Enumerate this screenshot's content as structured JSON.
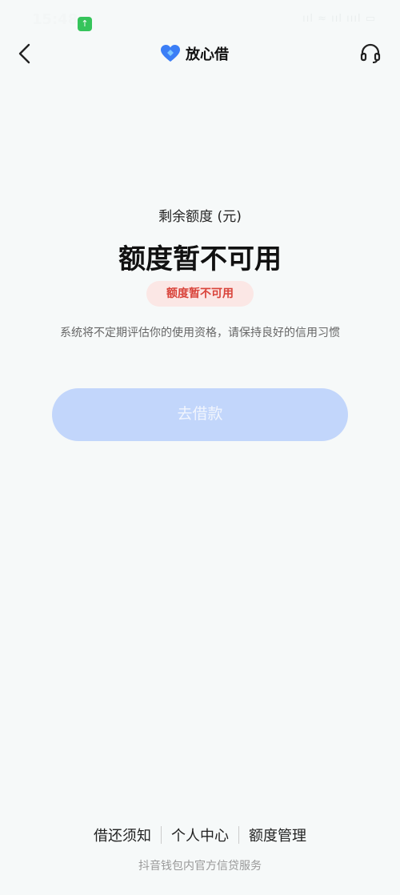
{
  "status_bar": {
    "time": "15:48",
    "signal_text": "ııl ≈ ııl ıııl ▭"
  },
  "nav": {
    "title": "放心借",
    "brand_color": "#3b7ef6"
  },
  "quota": {
    "label": "剩余额度 (元)",
    "value": "额度暂不可用",
    "badge": "额度暂不可用"
  },
  "notice": "系统将不定期评估你的使用资格，请保持良好的信用习惯",
  "borrow_button": "去借款",
  "footer": {
    "links": [
      "借还须知",
      "个人中心",
      "额度管理"
    ],
    "note": "抖音钱包内官方信贷服务"
  }
}
